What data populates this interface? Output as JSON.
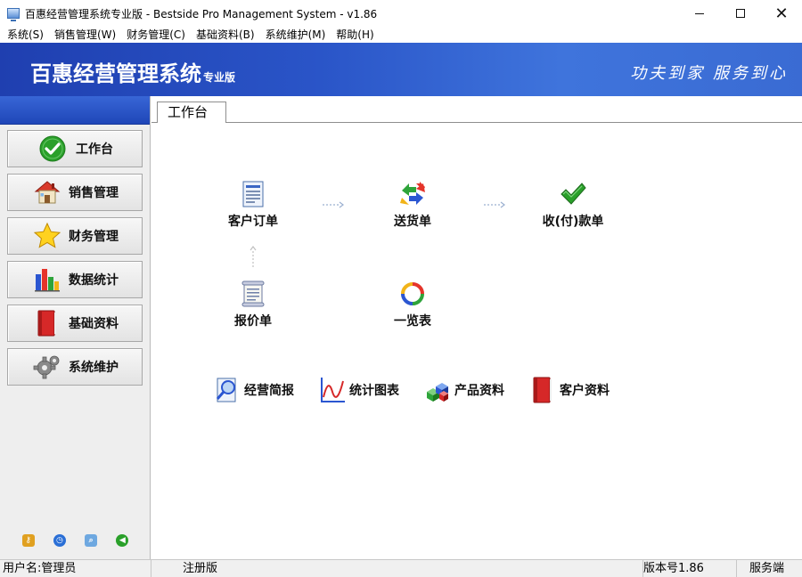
{
  "window": {
    "title": "百惠经营管理系统专业版 - Bestside Pro Management System - v1.86"
  },
  "menu": {
    "items": [
      {
        "label": "系统(S)"
      },
      {
        "label": "销售管理(W)"
      },
      {
        "label": "财务管理(C)"
      },
      {
        "label": "基础资料(B)"
      },
      {
        "label": "系统维护(M)"
      },
      {
        "label": "帮助(H)"
      }
    ]
  },
  "banner": {
    "brand": "百惠经营管理系统",
    "edition": "专业版",
    "slogan": "功夫到家 服务到心"
  },
  "sidebar": {
    "items": [
      {
        "label": "工作台",
        "icon": "check-circle-icon"
      },
      {
        "label": "销售管理",
        "icon": "house-icon"
      },
      {
        "label": "财务管理",
        "icon": "star-icon"
      },
      {
        "label": "数据统计",
        "icon": "bar-chart-icon"
      },
      {
        "label": "基础资料",
        "icon": "book-icon"
      },
      {
        "label": "系统维护",
        "icon": "gear-icon"
      }
    ],
    "bottom_icons": [
      "key-icon",
      "clock-icon",
      "search-icon",
      "back-arrow-icon"
    ]
  },
  "main": {
    "tab": "工作台",
    "flow": {
      "customer_order": "客户订单",
      "delivery": "送货单",
      "payment": "收(付)款单",
      "quotation": "报价单",
      "overview": "一览表"
    },
    "quick_links": {
      "brief_report": "经营简报",
      "stat_chart": "统计图表",
      "product_info": "产品资料",
      "customer_info": "客户资料"
    }
  },
  "status": {
    "user": "用户名:管理员",
    "registration": "注册版",
    "version": "版本号1.86",
    "mode": "服务端"
  },
  "colors": {
    "banner_blue": "#2a55c8",
    "check_green": "#2aa02a",
    "sidebar_bg": "#eeeeee"
  }
}
